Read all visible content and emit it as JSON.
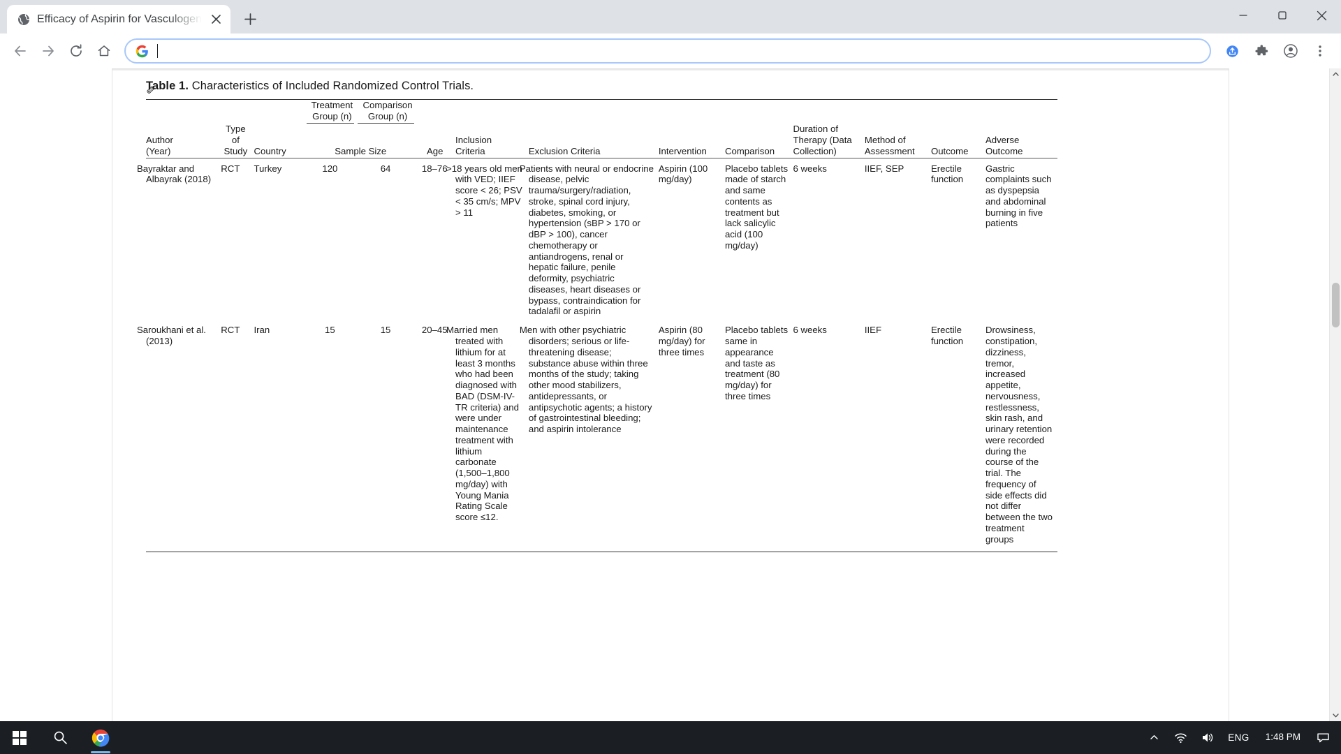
{
  "browser": {
    "tab": {
      "title": "Efficacy of Aspirin for Vasculogen",
      "favicon_icon": "globe-icon",
      "close_icon": "close-icon"
    },
    "new_tab_icon": "plus-icon",
    "window_controls": {
      "minimize_icon": "minimize-icon",
      "maximize_icon": "maximize-icon",
      "close_icon": "window-close-icon"
    },
    "toolbar": {
      "back_icon": "back-arrow-icon",
      "forward_icon": "forward-arrow-icon",
      "reload_icon": "reload-icon",
      "home_icon": "home-icon",
      "search_engine_icon": "google-g-icon",
      "address_value": "",
      "address_placeholder": "",
      "share_icon": "share-icon",
      "extensions_icon": "puzzle-piece-icon",
      "profile_icon": "account-circle-icon",
      "menu_icon": "three-dot-menu-icon"
    },
    "scrollbar": {
      "up_arrow_icon": "scroll-up-icon",
      "down_arrow_icon": "scroll-down-icon"
    }
  },
  "document": {
    "side_mark": "✐",
    "caption_label": "Table 1.",
    "caption_text": "Characteristics of Included Randomized Control Trials.",
    "span_headers": {
      "treatment_group": [
        "Treatment",
        "Group (n)"
      ],
      "comparison_group": [
        "Comparison",
        "Group (n)"
      ],
      "sample_size": "Sample Size"
    },
    "columns": [
      {
        "lines": [
          "Author",
          "(Year)"
        ]
      },
      {
        "lines": [
          "Type",
          "of",
          "Study"
        ]
      },
      {
        "lines": [
          "Country"
        ]
      },
      {
        "lines": [
          ""
        ]
      },
      {
        "lines": [
          ""
        ]
      },
      {
        "lines": [
          "Age"
        ]
      },
      {
        "lines": [
          "Inclusion",
          "Criteria"
        ]
      },
      {
        "lines": [
          "Exclusion Criteria"
        ]
      },
      {
        "lines": [
          "Intervention"
        ]
      },
      {
        "lines": [
          "Comparison"
        ]
      },
      {
        "lines": [
          "Duration of",
          "Therapy (Data",
          "Collection)"
        ]
      },
      {
        "lines": [
          "Method of",
          "Assessment"
        ]
      },
      {
        "lines": [
          "Outcome"
        ]
      },
      {
        "lines": [
          "Adverse",
          "Outcome"
        ]
      }
    ],
    "rows": [
      {
        "author": "Bayraktar and Albayrak (2018)",
        "type_of_study": "RCT",
        "country": "Turkey",
        "treatment_group_n": "120",
        "comparison_group_n": "64",
        "age": "18–76",
        "inclusion_criteria": ">18 years old men with VED; IIEF score < 26; PSV < 35 cm/s; MPV > 11",
        "exclusion_criteria": "Patients with neural or endocrine disease, pelvic trauma/surgery/radiation, stroke, spinal cord injury, diabetes, smoking, or hypertension (sBP > 170 or dBP > 100), cancer chemotherapy or antiandrogens, renal or hepatic failure, penile deformity, psychiatric diseases, heart diseases or bypass, contraindication for tadalafil or aspirin",
        "intervention": "Aspirin (100 mg/day)",
        "comparison": "Placebo tablets made of starch and same contents as treatment but lack salicylic acid (100 mg/day)",
        "duration_of_therapy": "6 weeks",
        "method_of_assessment": "IIEF, SEP",
        "outcome": "Erectile function",
        "adverse_outcome": "Gastric complaints such as dyspepsia and abdominal burning in five patients"
      },
      {
        "author": "Saroukhani et al. (2013)",
        "type_of_study": "RCT",
        "country": "Iran",
        "treatment_group_n": "15",
        "comparison_group_n": "15",
        "age": "20–45",
        "inclusion_criteria": "Married men treated with lithium for at least 3 months who had been diagnosed with BAD (DSM-IV-TR criteria) and were under maintenance treatment with lithium carbonate (1,500–1,800 mg/day) with Young Mania Rating Scale score ≤12.",
        "exclusion_criteria": "Men with other psychiatric disorders; serious or life-threatening disease; substance abuse within three months of the study; taking other mood stabilizers, antidepressants, or antipsychotic agents; a history of gastrointestinal bleeding; and aspirin intolerance",
        "intervention": "Aspirin (80 mg/day) for three times",
        "comparison": "Placebo tablets same in appearance and taste as treatment (80 mg/day) for three times",
        "duration_of_therapy": "6 weeks",
        "method_of_assessment": "IIEF",
        "outcome": "Erectile function",
        "adverse_outcome": "Drowsiness, constipation, dizziness, tremor, increased appetite, nervousness, restlessness, skin rash, and urinary retention were recorded during the course of the trial. The frequency of side effects did not differ between the two treatment groups"
      }
    ]
  },
  "taskbar": {
    "start_icon": "windows-start-icon",
    "search_icon": "taskbar-search-icon",
    "chrome_icon": "chrome-icon",
    "tray": {
      "overflow_icon": "chevron-up-icon",
      "network_icon": "wifi-icon",
      "volume_icon": "speaker-icon",
      "language": "ENG",
      "time": "1:48 PM",
      "notifications_icon": "notification-icon"
    }
  }
}
